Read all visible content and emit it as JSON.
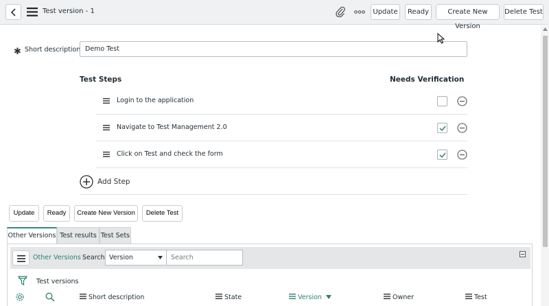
{
  "header": {
    "title": "Test version - 1",
    "buttons": {
      "update": "Update",
      "ready": "Ready",
      "create_new_version": "Create New Version",
      "delete_test": "Delete Test"
    }
  },
  "form": {
    "short_description_label": "Short description",
    "short_description_value": "Demo Test"
  },
  "steps": {
    "header": "Test Steps",
    "verification_header": "Needs Verification",
    "items": [
      {
        "label": "Login to the application",
        "needs_verification": false
      },
      {
        "label": "Navigate to Test Management 2.0",
        "needs_verification": true
      },
      {
        "label": "Click on Test and check the form",
        "needs_verification": true
      }
    ],
    "add_label": "Add Step"
  },
  "bottom_buttons": {
    "update": "Update",
    "ready": "Ready",
    "create_new_version": "Create New Version",
    "delete_test": "Delete Test"
  },
  "tabs": [
    {
      "label": "Other Versions",
      "active": true
    },
    {
      "label": "Test results",
      "active": false
    },
    {
      "label": "Test Sets",
      "active": false
    }
  ],
  "related_list": {
    "title": "Other Versions",
    "search_label": "Search",
    "search_field": "Version",
    "search_placeholder": "Search",
    "filter_label": "Test versions",
    "columns": [
      {
        "label": "Short description",
        "sorted": false
      },
      {
        "label": "State",
        "sorted": false
      },
      {
        "label": "Version",
        "sorted": true
      },
      {
        "label": "Owner",
        "sorted": false
      },
      {
        "label": "Test",
        "sorted": false
      }
    ]
  },
  "colors": {
    "accent": "#2e7f72",
    "header_bg": "#f0f1f2",
    "tab_bg": "#e4e6e7"
  }
}
